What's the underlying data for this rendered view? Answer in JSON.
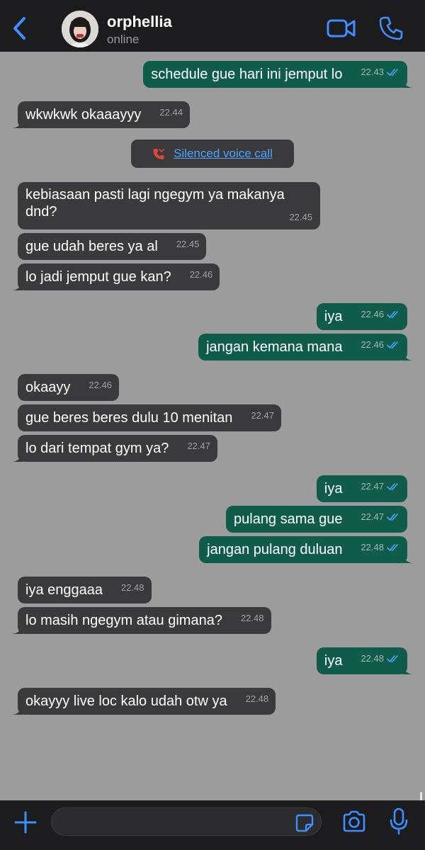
{
  "header": {
    "contact_name": "orphellia",
    "status": "online"
  },
  "call_notice": {
    "label": "Silenced voice call"
  },
  "messages": [
    {
      "text": "schedule gue hari ini jemput lo",
      "time": "22.43"
    },
    {
      "text": "wkwkwk okaaayyy",
      "time": "22.44"
    },
    {
      "text": "kebiasaan pasti lagi ngegym ya makanya\ndnd?",
      "time": "22.45"
    },
    {
      "text": "gue udah beres ya al",
      "time": "22.45"
    },
    {
      "text": "lo jadi jemput gue kan?",
      "time": "22.46"
    },
    {
      "text": "iya",
      "time": "22.46"
    },
    {
      "text": "jangan kemana mana",
      "time": "22.46"
    },
    {
      "text": "okaayy",
      "time": "22.46"
    },
    {
      "text": "gue beres beres dulu 10 menitan",
      "time": "22.47"
    },
    {
      "text": "lo dari tempat gym ya?",
      "time": "22.47"
    },
    {
      "text": "iya",
      "time": "22.47"
    },
    {
      "text": "pulang sama gue",
      "time": "22.47"
    },
    {
      "text": "jangan pulang duluan",
      "time": "22.48"
    },
    {
      "text": "iya enggaaa",
      "time": "22.48"
    },
    {
      "text": "lo masih ngegym atau gimana?",
      "time": "22.48"
    },
    {
      "text": "iya",
      "time": "22.48"
    },
    {
      "text": "okayyy live loc kalo udah otw ya",
      "time": "22.48"
    }
  ],
  "colors": {
    "chat_background": "#9c9c9c",
    "incoming_bubble": "#3a3a3c",
    "outgoing_bubble": "#0f5c4b",
    "accent": "#4aa3ff",
    "missed_call": "#e0453a"
  },
  "icons": {
    "back": "chevron-left-icon",
    "video": "video-call-icon",
    "phone": "voice-call-icon",
    "read": "double-check-icon",
    "missed": "missed-call-icon",
    "attach": "plus-icon",
    "sticker": "sticker-icon",
    "camera": "camera-icon",
    "mic": "microphone-icon"
  }
}
